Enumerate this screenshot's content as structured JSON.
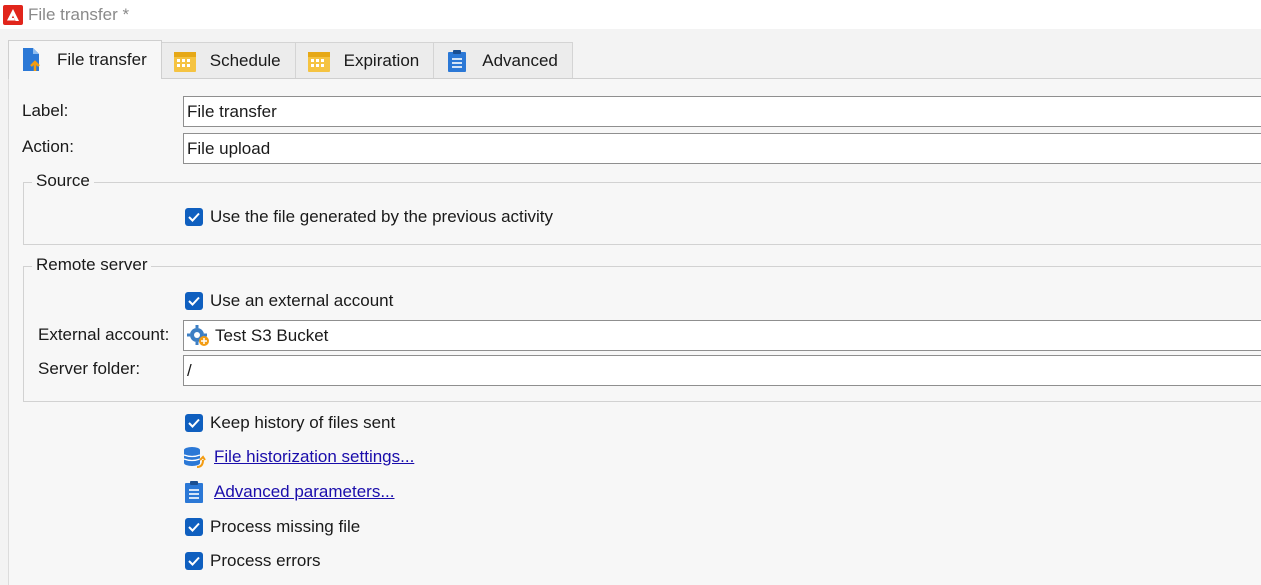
{
  "window": {
    "title": "File transfer *",
    "app_icon": "adobe-logo-icon"
  },
  "tabs": [
    {
      "label": "File transfer",
      "icon": "file-upload-icon",
      "active": true
    },
    {
      "label": "Schedule",
      "icon": "calendar-icon",
      "active": false
    },
    {
      "label": "Expiration",
      "icon": "calendar-icon",
      "active": false
    },
    {
      "label": "Advanced",
      "icon": "clipboard-icon",
      "active": false
    }
  ],
  "form": {
    "label_field": {
      "label": "Label:",
      "value": "File transfer"
    },
    "action_field": {
      "label": "Action:",
      "value": "File upload"
    }
  },
  "source": {
    "legend": "Source",
    "use_generated_file": {
      "label": "Use the file generated by the previous activity",
      "checked": true
    }
  },
  "remote_server": {
    "legend": "Remote server",
    "use_external_account": {
      "label": "Use an external account",
      "checked": true
    },
    "external_account": {
      "label": "External account:",
      "value": "Test S3 Bucket",
      "icon": "gear-account-icon"
    },
    "server_folder": {
      "label": "Server folder:",
      "value": "/"
    }
  },
  "options": {
    "keep_history": {
      "label": "Keep history of files sent",
      "checked": true
    },
    "historization_link": {
      "label": "File historization settings...",
      "icon": "database-icon"
    },
    "advanced_params_link": {
      "label": "Advanced parameters...",
      "icon": "clipboard-icon"
    },
    "process_missing": {
      "label": "Process missing file",
      "checked": true
    },
    "process_errors": {
      "label": "Process errors",
      "checked": true
    }
  },
  "colors": {
    "accent": "#0f5fbf",
    "link": "#1a0dab",
    "brand": "#e1251b"
  }
}
